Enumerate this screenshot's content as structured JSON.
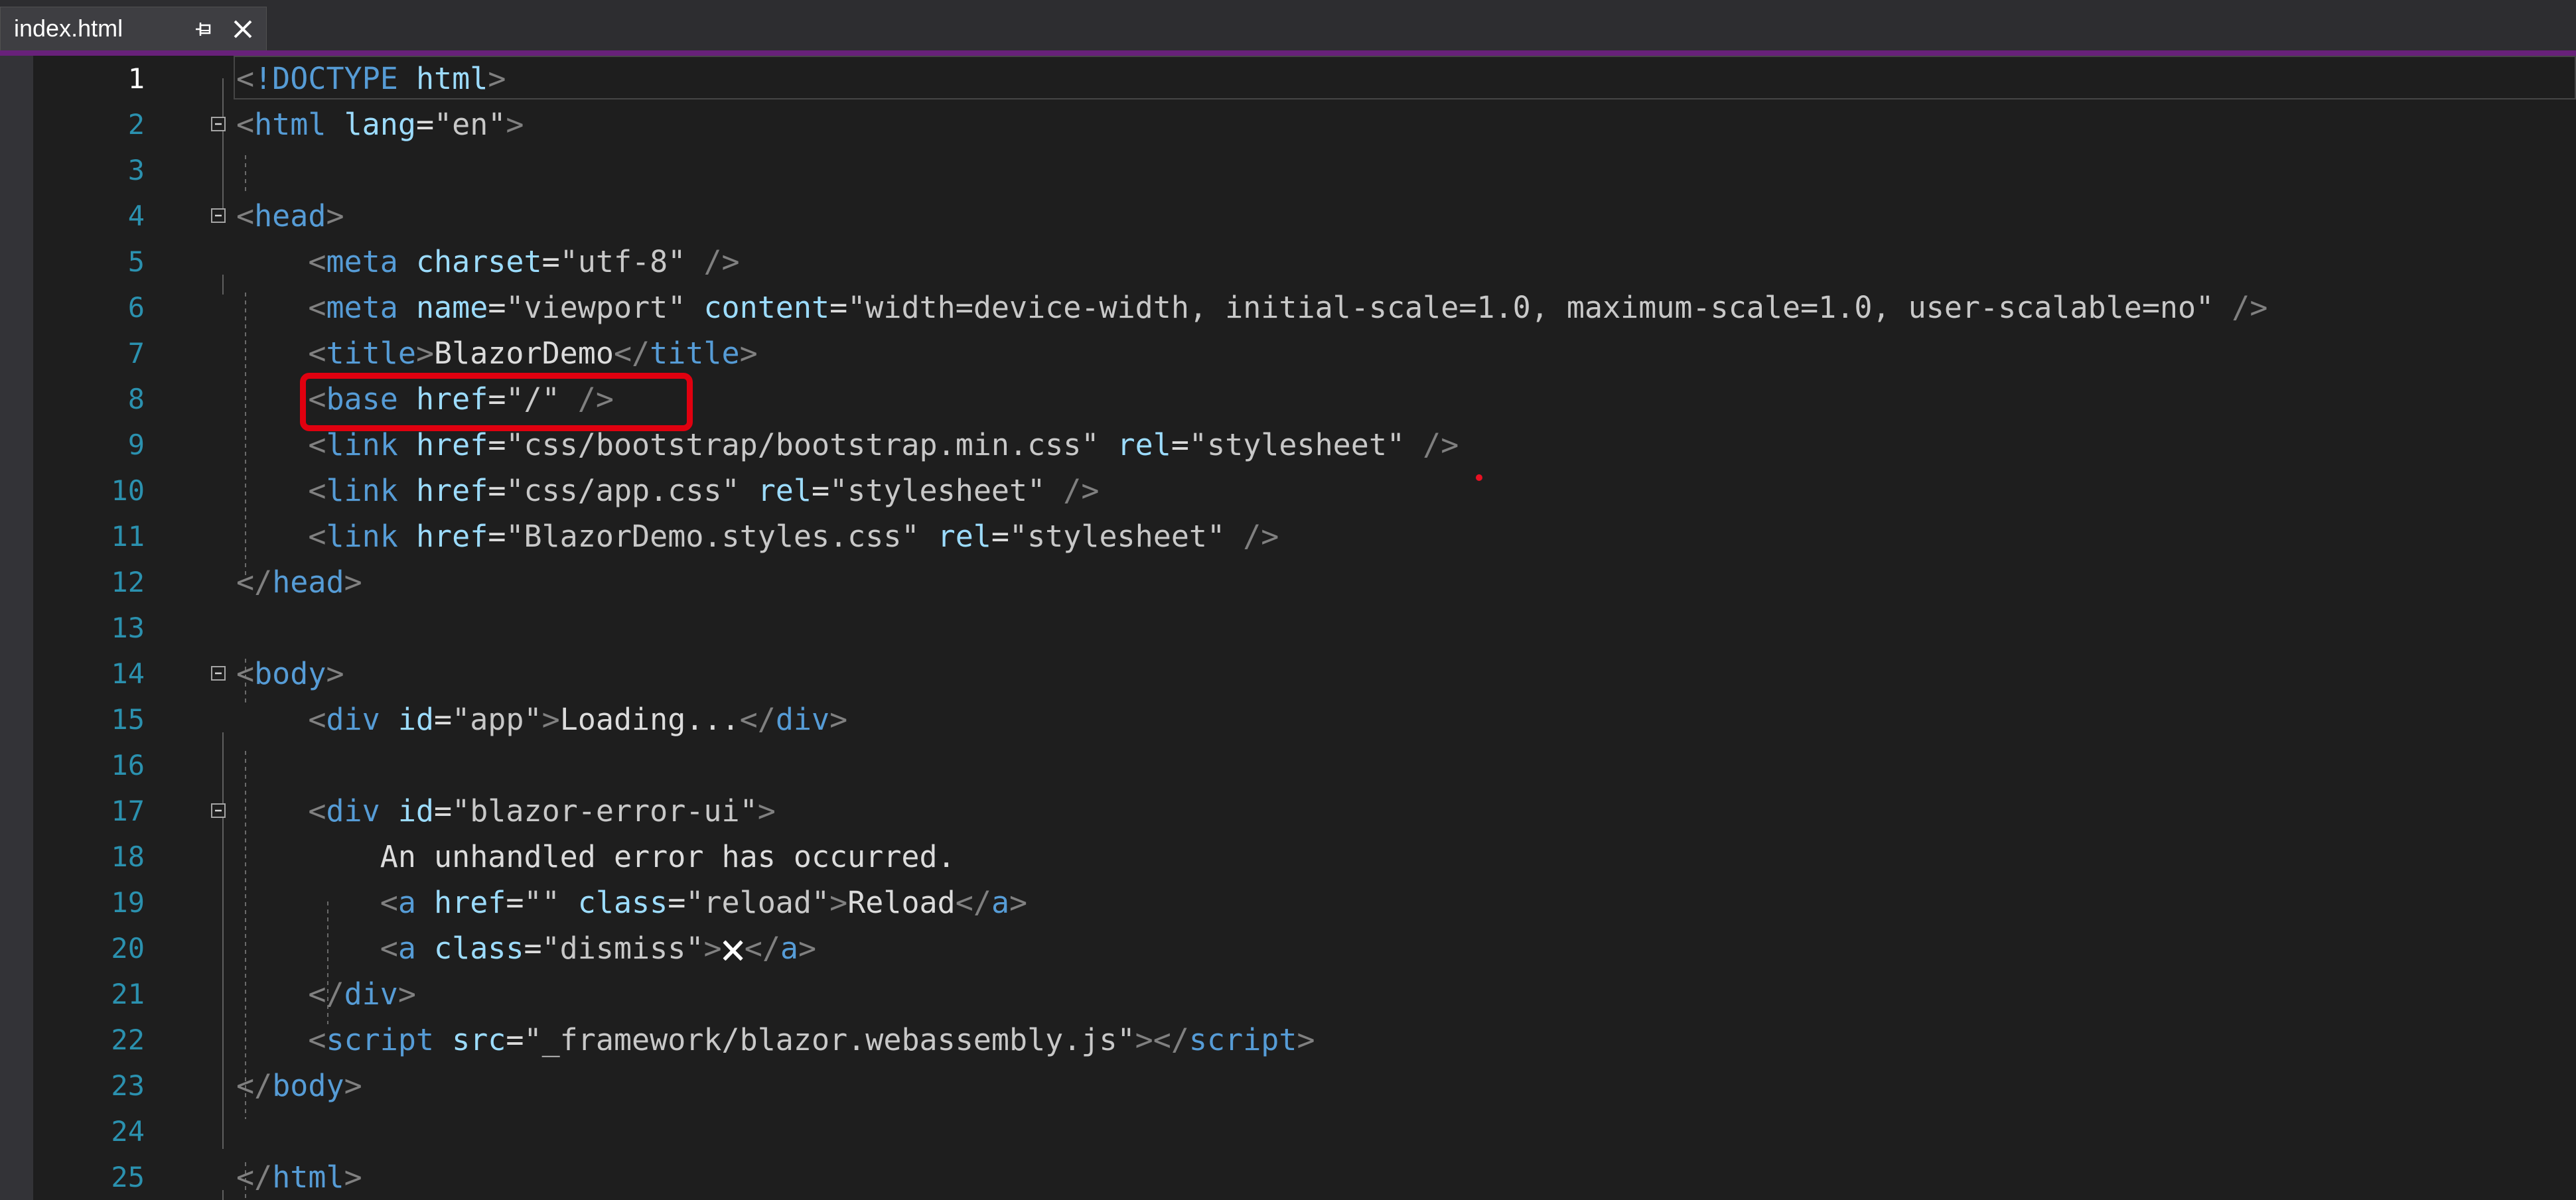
{
  "tab": {
    "title": "index.html",
    "pin_icon": "pin-icon",
    "close_icon": "close-icon"
  },
  "colors": {
    "accent": "#68217a",
    "highlight": "#e0000f",
    "tag": "#569cd6",
    "attribute": "#9cdcfe",
    "delimiter": "#808080",
    "string": "#c8c8c8",
    "text": "#dcdcdc",
    "line_number": "#2b91af"
  },
  "editor": {
    "active_line": 1,
    "highlighted_line": 8,
    "lines": [
      {
        "num": "1",
        "fold": false,
        "indent": "",
        "tokens": [
          {
            "t": "del",
            "v": "<"
          },
          {
            "t": "tag",
            "v": "!DOCTYPE"
          },
          {
            "t": "text",
            "v": " "
          },
          {
            "t": "attr",
            "v": "html"
          },
          {
            "t": "del",
            "v": ">"
          }
        ]
      },
      {
        "num": "2",
        "fold": true,
        "indent": "",
        "tokens": [
          {
            "t": "del",
            "v": "<"
          },
          {
            "t": "tag",
            "v": "html"
          },
          {
            "t": "text",
            "v": " "
          },
          {
            "t": "attr",
            "v": "lang"
          },
          {
            "t": "text",
            "v": "="
          },
          {
            "t": "val",
            "v": "\"en\""
          },
          {
            "t": "del",
            "v": ">"
          }
        ]
      },
      {
        "num": "3",
        "fold": false,
        "indent": "",
        "tokens": []
      },
      {
        "num": "4",
        "fold": true,
        "indent": "",
        "tokens": [
          {
            "t": "del",
            "v": "<"
          },
          {
            "t": "tag",
            "v": "head"
          },
          {
            "t": "del",
            "v": ">"
          }
        ]
      },
      {
        "num": "5",
        "fold": false,
        "indent": "    ",
        "tokens": [
          {
            "t": "del",
            "v": "<"
          },
          {
            "t": "tag",
            "v": "meta"
          },
          {
            "t": "text",
            "v": " "
          },
          {
            "t": "attr",
            "v": "charset"
          },
          {
            "t": "text",
            "v": "="
          },
          {
            "t": "val",
            "v": "\"utf-8\""
          },
          {
            "t": "text",
            "v": " "
          },
          {
            "t": "del",
            "v": "/>"
          }
        ]
      },
      {
        "num": "6",
        "fold": false,
        "indent": "    ",
        "tokens": [
          {
            "t": "del",
            "v": "<"
          },
          {
            "t": "tag",
            "v": "meta"
          },
          {
            "t": "text",
            "v": " "
          },
          {
            "t": "attr",
            "v": "name"
          },
          {
            "t": "text",
            "v": "="
          },
          {
            "t": "val",
            "v": "\"viewport\""
          },
          {
            "t": "text",
            "v": " "
          },
          {
            "t": "attr",
            "v": "content"
          },
          {
            "t": "text",
            "v": "="
          },
          {
            "t": "val",
            "v": "\"width=device-width, initial-scale=1.0, maximum-scale=1.0, user-scalable=no\""
          },
          {
            "t": "text",
            "v": " "
          },
          {
            "t": "del",
            "v": "/>"
          }
        ]
      },
      {
        "num": "7",
        "fold": false,
        "indent": "    ",
        "tokens": [
          {
            "t": "del",
            "v": "<"
          },
          {
            "t": "tag",
            "v": "title"
          },
          {
            "t": "del",
            "v": ">"
          },
          {
            "t": "text",
            "v": "BlazorDemo"
          },
          {
            "t": "del",
            "v": "</"
          },
          {
            "t": "tag",
            "v": "title"
          },
          {
            "t": "del",
            "v": ">"
          }
        ]
      },
      {
        "num": "8",
        "fold": false,
        "indent": "    ",
        "tokens": [
          {
            "t": "del",
            "v": "<"
          },
          {
            "t": "tag",
            "v": "base"
          },
          {
            "t": "text",
            "v": " "
          },
          {
            "t": "attr",
            "v": "href"
          },
          {
            "t": "text",
            "v": "="
          },
          {
            "t": "val",
            "v": "\"/\""
          },
          {
            "t": "text",
            "v": " "
          },
          {
            "t": "del",
            "v": "/>"
          }
        ]
      },
      {
        "num": "9",
        "fold": false,
        "indent": "    ",
        "tokens": [
          {
            "t": "del",
            "v": "<"
          },
          {
            "t": "tag",
            "v": "link"
          },
          {
            "t": "text",
            "v": " "
          },
          {
            "t": "attr",
            "v": "href"
          },
          {
            "t": "text",
            "v": "="
          },
          {
            "t": "val",
            "v": "\"css/bootstrap/bootstrap.min.css\""
          },
          {
            "t": "text",
            "v": " "
          },
          {
            "t": "attr",
            "v": "rel"
          },
          {
            "t": "text",
            "v": "="
          },
          {
            "t": "val",
            "v": "\"stylesheet\""
          },
          {
            "t": "text",
            "v": " "
          },
          {
            "t": "del",
            "v": "/>"
          }
        ]
      },
      {
        "num": "10",
        "fold": false,
        "indent": "    ",
        "tokens": [
          {
            "t": "del",
            "v": "<"
          },
          {
            "t": "tag",
            "v": "link"
          },
          {
            "t": "text",
            "v": " "
          },
          {
            "t": "attr",
            "v": "href"
          },
          {
            "t": "text",
            "v": "="
          },
          {
            "t": "val",
            "v": "\"css/app.css\""
          },
          {
            "t": "text",
            "v": " "
          },
          {
            "t": "attr",
            "v": "rel"
          },
          {
            "t": "text",
            "v": "="
          },
          {
            "t": "val",
            "v": "\"stylesheet\""
          },
          {
            "t": "text",
            "v": " "
          },
          {
            "t": "del",
            "v": "/>"
          }
        ]
      },
      {
        "num": "11",
        "fold": false,
        "indent": "    ",
        "tokens": [
          {
            "t": "del",
            "v": "<"
          },
          {
            "t": "tag",
            "v": "link"
          },
          {
            "t": "text",
            "v": " "
          },
          {
            "t": "attr",
            "v": "href"
          },
          {
            "t": "text",
            "v": "="
          },
          {
            "t": "val",
            "v": "\"BlazorDemo.styles.css\""
          },
          {
            "t": "text",
            "v": " "
          },
          {
            "t": "attr",
            "v": "rel"
          },
          {
            "t": "text",
            "v": "="
          },
          {
            "t": "val",
            "v": "\"stylesheet\""
          },
          {
            "t": "text",
            "v": " "
          },
          {
            "t": "del",
            "v": "/>"
          }
        ]
      },
      {
        "num": "12",
        "fold": false,
        "indent": "",
        "tokens": [
          {
            "t": "del",
            "v": "</"
          },
          {
            "t": "tag",
            "v": "head"
          },
          {
            "t": "del",
            "v": ">"
          }
        ]
      },
      {
        "num": "13",
        "fold": false,
        "indent": "",
        "tokens": []
      },
      {
        "num": "14",
        "fold": true,
        "indent": "",
        "tokens": [
          {
            "t": "del",
            "v": "<"
          },
          {
            "t": "tag",
            "v": "body"
          },
          {
            "t": "del",
            "v": ">"
          }
        ]
      },
      {
        "num": "15",
        "fold": false,
        "indent": "    ",
        "tokens": [
          {
            "t": "del",
            "v": "<"
          },
          {
            "t": "tag",
            "v": "div"
          },
          {
            "t": "text",
            "v": " "
          },
          {
            "t": "attr",
            "v": "id"
          },
          {
            "t": "text",
            "v": "="
          },
          {
            "t": "val",
            "v": "\"app\""
          },
          {
            "t": "del",
            "v": ">"
          },
          {
            "t": "text",
            "v": "Loading..."
          },
          {
            "t": "del",
            "v": "</"
          },
          {
            "t": "tag",
            "v": "div"
          },
          {
            "t": "del",
            "v": ">"
          }
        ]
      },
      {
        "num": "16",
        "fold": false,
        "indent": "",
        "tokens": []
      },
      {
        "num": "17",
        "fold": true,
        "indent": "    ",
        "tokens": [
          {
            "t": "del",
            "v": "<"
          },
          {
            "t": "tag",
            "v": "div"
          },
          {
            "t": "text",
            "v": " "
          },
          {
            "t": "attr",
            "v": "id"
          },
          {
            "t": "text",
            "v": "="
          },
          {
            "t": "val",
            "v": "\"blazor-error-ui\""
          },
          {
            "t": "del",
            "v": ">"
          }
        ]
      },
      {
        "num": "18",
        "fold": false,
        "indent": "        ",
        "tokens": [
          {
            "t": "text",
            "v": "An unhandled error has occurred."
          }
        ]
      },
      {
        "num": "19",
        "fold": false,
        "indent": "        ",
        "tokens": [
          {
            "t": "del",
            "v": "<"
          },
          {
            "t": "tag",
            "v": "a"
          },
          {
            "t": "text",
            "v": " "
          },
          {
            "t": "attr",
            "v": "href"
          },
          {
            "t": "text",
            "v": "="
          },
          {
            "t": "val",
            "v": "\"\""
          },
          {
            "t": "text",
            "v": " "
          },
          {
            "t": "attr",
            "v": "class"
          },
          {
            "t": "text",
            "v": "="
          },
          {
            "t": "val",
            "v": "\"reload\""
          },
          {
            "t": "del",
            "v": ">"
          },
          {
            "t": "text",
            "v": "Reload"
          },
          {
            "t": "del",
            "v": "</"
          },
          {
            "t": "tag",
            "v": "a"
          },
          {
            "t": "del",
            "v": ">"
          }
        ]
      },
      {
        "num": "20",
        "fold": false,
        "indent": "        ",
        "tokens": [
          {
            "t": "del",
            "v": "<"
          },
          {
            "t": "tag",
            "v": "a"
          },
          {
            "t": "text",
            "v": " "
          },
          {
            "t": "attr",
            "v": "class"
          },
          {
            "t": "text",
            "v": "="
          },
          {
            "t": "val",
            "v": "\"dismiss\""
          },
          {
            "t": "del",
            "v": ">"
          },
          {
            "t": "ent",
            "v": "🗙"
          },
          {
            "t": "del",
            "v": "</"
          },
          {
            "t": "tag",
            "v": "a"
          },
          {
            "t": "del",
            "v": ">"
          }
        ]
      },
      {
        "num": "21",
        "fold": false,
        "indent": "    ",
        "tokens": [
          {
            "t": "del",
            "v": "</"
          },
          {
            "t": "tag",
            "v": "div"
          },
          {
            "t": "del",
            "v": ">"
          }
        ]
      },
      {
        "num": "22",
        "fold": false,
        "indent": "    ",
        "tokens": [
          {
            "t": "del",
            "v": "<"
          },
          {
            "t": "tag",
            "v": "script"
          },
          {
            "t": "text",
            "v": " "
          },
          {
            "t": "attr",
            "v": "src"
          },
          {
            "t": "text",
            "v": "="
          },
          {
            "t": "val",
            "v": "\"_framework/blazor.webassembly.js\""
          },
          {
            "t": "del",
            "v": "></"
          },
          {
            "t": "tag",
            "v": "script"
          },
          {
            "t": "del",
            "v": ">"
          }
        ]
      },
      {
        "num": "23",
        "fold": false,
        "indent": "",
        "tokens": [
          {
            "t": "del",
            "v": "</"
          },
          {
            "t": "tag",
            "v": "body"
          },
          {
            "t": "del",
            "v": ">"
          }
        ]
      },
      {
        "num": "24",
        "fold": false,
        "indent": "",
        "tokens": []
      },
      {
        "num": "25",
        "fold": false,
        "indent": "",
        "tokens": [
          {
            "t": "del",
            "v": "</"
          },
          {
            "t": "tag",
            "v": "html"
          },
          {
            "t": "del",
            "v": ">"
          }
        ]
      }
    ]
  }
}
